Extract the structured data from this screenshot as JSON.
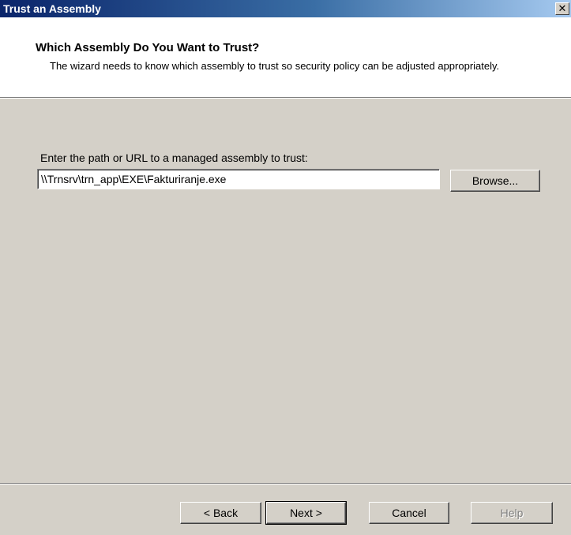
{
  "window": {
    "title": "Trust an Assembly",
    "close_symbol": "✕"
  },
  "header": {
    "heading": "Which Assembly Do You Want to Trust?",
    "description": "The wizard needs to know which assembly to trust so security policy can be adjusted appropriately."
  },
  "form": {
    "path_label": "Enter the path or URL to a managed assembly to trust:",
    "path_value": "\\\\Trnsrv\\trn_app\\EXE\\Fakturiranje.exe",
    "browse_label": "Browse..."
  },
  "footer": {
    "back_label": "< Back",
    "next_label": "Next >",
    "cancel_label": "Cancel",
    "help_label": "Help",
    "help_enabled": false
  },
  "colors": {
    "titlebar_start": "#0a246a",
    "titlebar_end": "#a6caf0",
    "dialog_face": "#d4d0c8",
    "header_bg": "#ffffff"
  },
  "icons": {
    "close": "close-icon"
  }
}
